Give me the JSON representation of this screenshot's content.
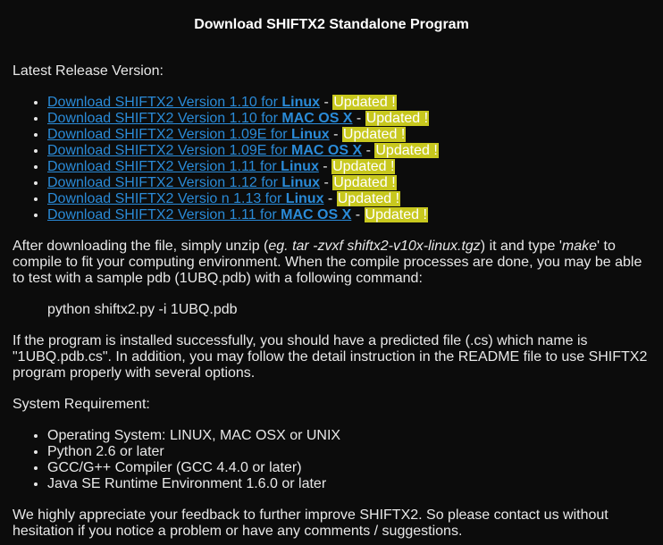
{
  "title": "Download SHIFTX2 Standalone Program",
  "latest_label": "Latest Release Version:",
  "downloads": [
    {
      "prefix": "Download SHIFTX2 Version 1.10 for ",
      "os": "Linux",
      "sep": " - ",
      "badge": "Updated !"
    },
    {
      "prefix": "Download SHIFTX2 Version 1.10 for ",
      "os": "MAC OS X",
      "sep": " - ",
      "badge": "Updated !"
    },
    {
      "prefix": "Download SHIFTX2 Version 1.09E for ",
      "os": "Linux",
      "sep": " - ",
      "badge": "Updated !"
    },
    {
      "prefix": "Download SHIFTX2 Version 1.09E for ",
      "os": "MAC OS X",
      "sep": " - ",
      "badge": "Updated !"
    },
    {
      "prefix": "Download SHIFTX2 Version 1.11 for ",
      "os": "Linux",
      "sep": " - ",
      "badge": "Updated !"
    },
    {
      "prefix": "Download SHIFTX2 Version 1.12 for ",
      "os": "Linux",
      "sep": " - ",
      "badge": "Updated !"
    },
    {
      "prefix": "Download SHIFTX2 Versio n 1.13 for ",
      "os": "Linux",
      "sep": " - ",
      "badge": "Updated !"
    },
    {
      "prefix": "Download SHIFTX2 Version 1.11 for ",
      "os": "MAC OS X",
      "sep": " - ",
      "badge": "Updated !"
    }
  ],
  "para1": {
    "a": "After downloading the file, simply unzip (",
    "eg": "eg. tar -zvxf shiftx2-v10x-linux.tgz",
    "b": ") it and type '",
    "make": "make",
    "c": "' to compile to fit your computing environment. When the compile processes are done, you may be able to test with a sample pdb (1UBQ.pdb) with a following command:"
  },
  "command": "python shiftx2.py -i 1UBQ.pdb",
  "para2": "If the program is installed successfully, you should have a predicted file (.cs) which name is \"1UBQ.pdb.cs\". In addition, you may follow the detail instruction in the README file to use SHIFTX2 program properly with several options.",
  "req_label": "System Requirement:",
  "requirements": [
    "Operating System: LINUX, MAC OSX or UNIX",
    "Python 2.6 or later",
    "GCC/G++ Compiler (GCC 4.4.0 or later)",
    "Java SE Runtime Environment 1.6.0 or later"
  ],
  "para3": "We highly appreciate your feedback to further improve SHIFTX2. So please contact us without hesitation if you notice a problem or have any comments / suggestions.",
  "colors": {
    "background": "#0c0c0c",
    "text": "#e8e8e8",
    "link": "#2a8bd8",
    "badge_bg": "#c8c81e"
  }
}
